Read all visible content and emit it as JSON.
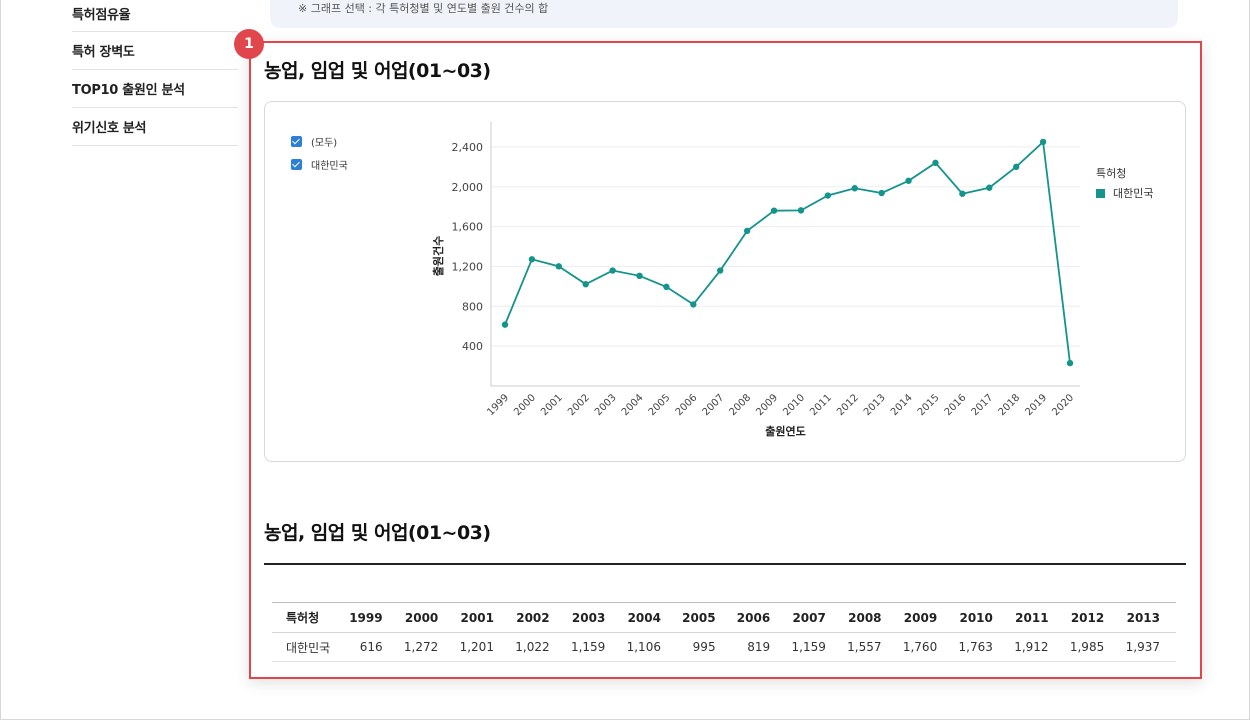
{
  "sidebar": {
    "items": [
      "특허점유율",
      "특허 장벽도",
      "TOP10 출원인 분석",
      "위기신호 분석"
    ]
  },
  "notice": "※ 그래프 선택 : 각 특허청별 및 연도별 출원 건수의 합",
  "badge": "1",
  "section_title": "농업, 임업 및 어업(01~03)",
  "table_title": "농업, 임업 및 어업(01~03)",
  "filters": [
    "(모두)",
    "대한민국"
  ],
  "legend": {
    "title": "특허청",
    "items": [
      "대한민국"
    ]
  },
  "colors": {
    "accent": "#e0474c",
    "series": "#14948a",
    "checkbox": "#2e7fd6"
  },
  "chart_data": {
    "type": "line",
    "xlabel": "출원연도",
    "ylabel": "출원건수",
    "ylim": [
      0,
      2650
    ],
    "yticks": [
      400,
      800,
      1200,
      1600,
      2000,
      2400
    ],
    "ytick_labels": [
      "400",
      "800",
      "1,200",
      "1,600",
      "2,000",
      "2,400"
    ],
    "x": [
      "1999",
      "2000",
      "2001",
      "2002",
      "2003",
      "2004",
      "2005",
      "2006",
      "2007",
      "2008",
      "2009",
      "2010",
      "2011",
      "2012",
      "2013",
      "2014",
      "2015",
      "2016",
      "2017",
      "2018",
      "2019",
      "2020"
    ],
    "series": [
      {
        "name": "대한민국",
        "values": [
          616,
          1272,
          1201,
          1022,
          1159,
          1106,
          995,
          819,
          1159,
          1557,
          1760,
          1763,
          1912,
          1985,
          1937,
          2060,
          2240,
          1930,
          1990,
          2200,
          2450,
          230
        ]
      }
    ],
    "grid": true
  },
  "table": {
    "header": [
      "특허청",
      "1999",
      "2000",
      "2001",
      "2002",
      "2003",
      "2004",
      "2005",
      "2006",
      "2007",
      "2008",
      "2009",
      "2010",
      "2011",
      "2012",
      "2013"
    ],
    "rows": [
      [
        "대한민국",
        "616",
        "1,272",
        "1,201",
        "1,022",
        "1,159",
        "1,106",
        "995",
        "819",
        "1,159",
        "1,557",
        "1,760",
        "1,763",
        "1,912",
        "1,985",
        "1,937"
      ]
    ]
  }
}
